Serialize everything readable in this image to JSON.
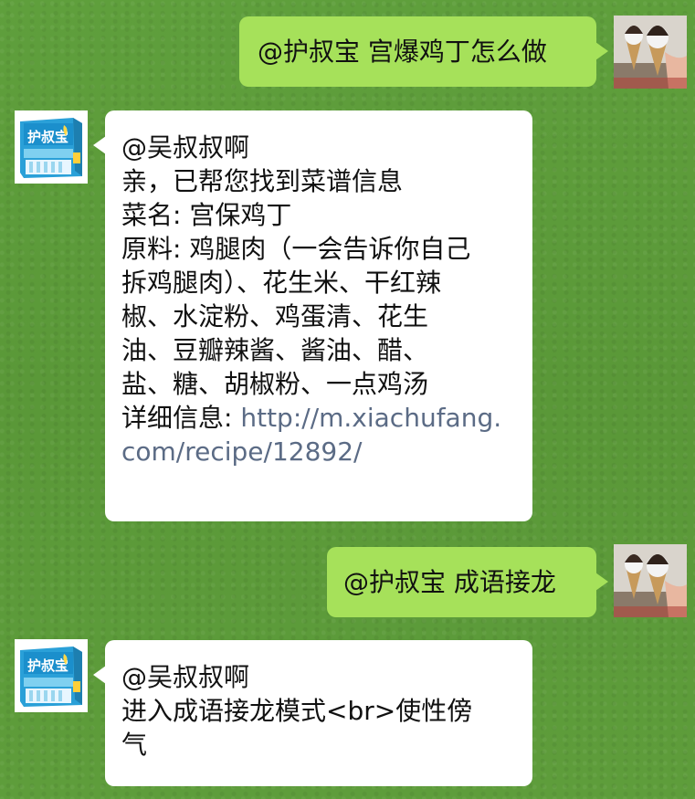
{
  "messages": [
    {
      "side": "right",
      "text": "@护叔宝 宫爆鸡丁怎么做",
      "avatar": "ice-cream-avatar"
    },
    {
      "side": "left",
      "avatar": "product-box-avatar",
      "lines": [
        "@吴叔叔啊",
        "亲，已帮您找到菜谱信息",
        "菜名: 宫保鸡丁",
        "原料: 鸡腿肉（一会告诉你自己",
        "拆鸡腿肉）、花生米、干红辣",
        "椒、水淀粉、鸡蛋清、花生",
        "油、豆瓣辣酱、酱油、醋、",
        "盐、糖、胡椒粉、一点鸡汤"
      ],
      "detail_label": "详细信息: ",
      "link_part1": "http://m.xiachufang.",
      "link_part2": "com/recipe/12892/"
    },
    {
      "side": "right",
      "text": "@护叔宝 成语接龙",
      "avatar": "ice-cream-avatar"
    },
    {
      "side": "left",
      "avatar": "product-box-avatar",
      "lines": [
        "@吴叔叔啊",
        "进入成语接龙模式<br>使性傍",
        "气"
      ]
    }
  ],
  "product_box_logo": "护叔宝",
  "colors": {
    "background": "#5c9b3a",
    "bubble_right": "#a6e15a",
    "bubble_left": "#ffffff",
    "link": "#5b6b85"
  }
}
